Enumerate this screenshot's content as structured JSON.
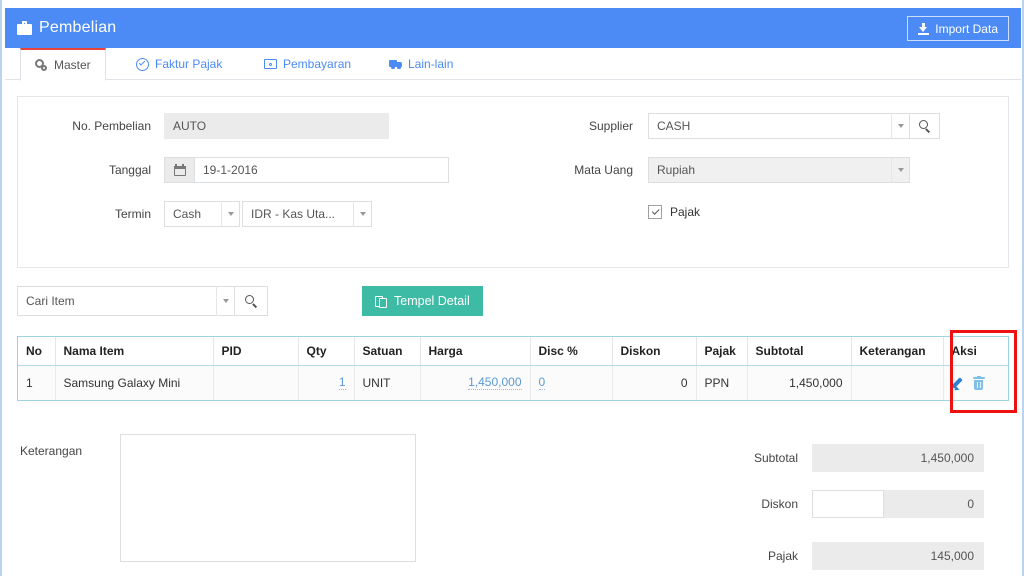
{
  "header": {
    "title": "Pembelian",
    "icon": "briefcase-icon",
    "import_label": "Import Data",
    "brand_color": "#4c8bf5"
  },
  "tabs": [
    {
      "label": "Master",
      "icon": "gears-icon",
      "active": true
    },
    {
      "label": "Faktur Pajak",
      "icon": "check-circle-icon",
      "active": false
    },
    {
      "label": "Pembayaran",
      "icon": "money-icon",
      "active": false
    },
    {
      "label": "Lain-lain",
      "icon": "truck-icon",
      "active": false
    }
  ],
  "form": {
    "no_pembelian": {
      "label": "No. Pembelian",
      "value": "AUTO"
    },
    "tanggal": {
      "label": "Tanggal",
      "value": "19-1-2016",
      "icon": "calendar-icon"
    },
    "termin": {
      "label": "Termin",
      "value": "Cash",
      "account": "IDR - Kas Uta..."
    },
    "supplier": {
      "label": "Supplier",
      "value": "CASH",
      "search_icon": "search-icon"
    },
    "mata_uang": {
      "label": "Mata Uang",
      "value": "Rupiah"
    },
    "pajak": {
      "label": "Pajak",
      "checked": true
    }
  },
  "item_search": {
    "placeholder": "Cari Item",
    "value": "",
    "search_icon": "search-icon",
    "tempel_label": "Tempel Detail",
    "tempel_color": "#3dbba4"
  },
  "items_table": {
    "columns": [
      "No",
      "Nama Item",
      "PID",
      "Qty",
      "Satuan",
      "Harga",
      "Disc %",
      "Diskon",
      "Pajak",
      "Subtotal",
      "Keterangan",
      "Aksi"
    ],
    "rows": [
      {
        "no": "1",
        "nama_item": "Samsung Galaxy Mini",
        "pid": "",
        "qty": "1",
        "satuan": "UNIT",
        "harga": "1,450,000",
        "disc_pct": "0",
        "diskon": "0",
        "pajak": "PPN",
        "subtotal": "1,450,000",
        "keterangan": "",
        "edit_icon": "pencil-icon",
        "delete_icon": "trash-icon"
      }
    ],
    "highlight_color": "#ee1111",
    "highlighted_column": "Aksi"
  },
  "footer": {
    "keterangan_label": "Keterangan",
    "keterangan_value": "",
    "totals": [
      {
        "label": "Subtotal",
        "value": "1,450,000",
        "editable": false
      },
      {
        "label": "Diskon",
        "value": "0",
        "editable": true,
        "input_value": ""
      },
      {
        "label": "Pajak",
        "value": "145,000",
        "editable": false
      }
    ]
  }
}
